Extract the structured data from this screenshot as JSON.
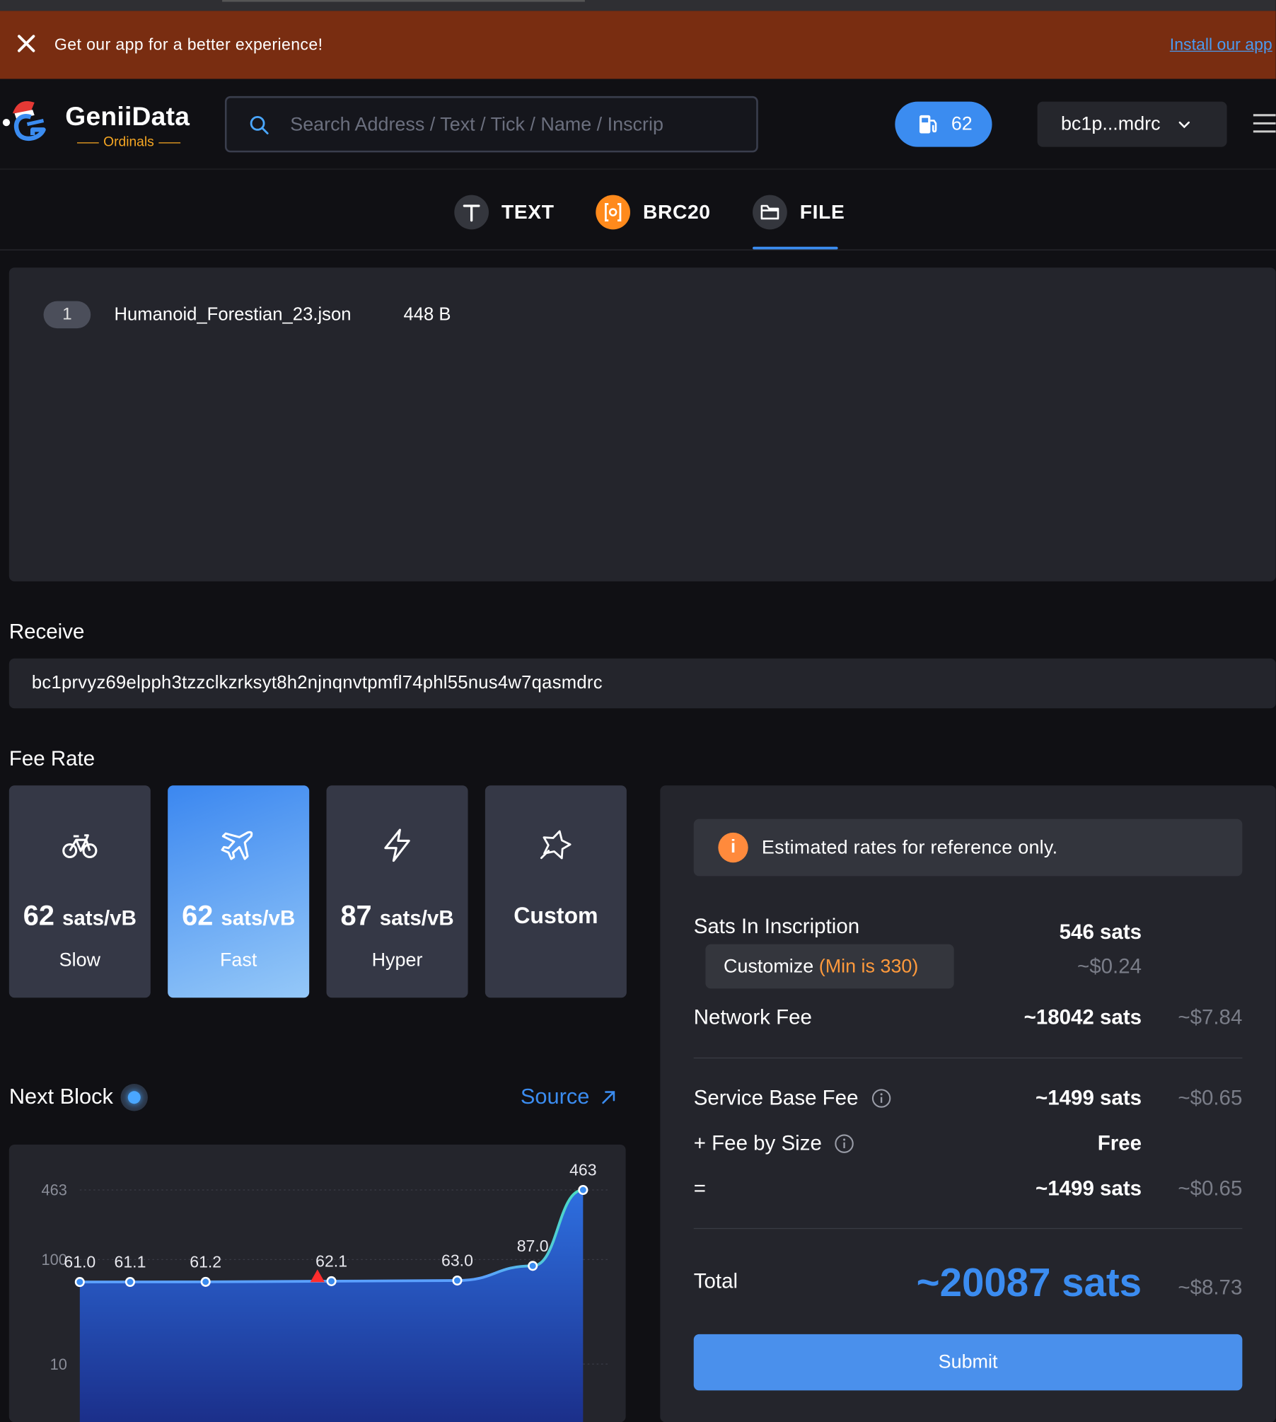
{
  "banner": {
    "message": "Get our app for a better experience!",
    "install_label": "Install our app"
  },
  "header": {
    "logo_name": "GeniiData",
    "logo_sub": "Ordinals",
    "search_placeholder": "Search Address / Text / Tick / Name / Inscrip",
    "gas_value": "62",
    "wallet": "bc1p...mdrc"
  },
  "tabs": [
    {
      "label": "TEXT"
    },
    {
      "label": "BRC20"
    },
    {
      "label": "FILE"
    }
  ],
  "file": {
    "index": "1",
    "name": "Humanoid_Forestian_23.json",
    "size": "448 B"
  },
  "receive": {
    "label": "Receive",
    "address": "bc1prvyz69elpph3tzzclkzrksyt8h2njnqnvtpmfl74phl55nus4w7qasmdrc"
  },
  "fee_rate": {
    "label": "Fee Rate",
    "options": [
      {
        "rate": "62",
        "unit": "sats/vB",
        "speed": "Slow",
        "icon": "bicycle-icon"
      },
      {
        "rate": "62",
        "unit": "sats/vB",
        "speed": "Fast",
        "icon": "airplane-icon"
      },
      {
        "rate": "87",
        "unit": "sats/vB",
        "speed": "Hyper",
        "icon": "lightning-icon"
      },
      {
        "label": "Custom",
        "icon": "custom-star-icon"
      }
    ],
    "selected_index": 1
  },
  "next_block": {
    "label": "Next Block",
    "source_label": "Source"
  },
  "chart_data": {
    "type": "area",
    "x": [
      1,
      2,
      3,
      4,
      5,
      6,
      7
    ],
    "values": [
      61.0,
      61.1,
      61.2,
      62.1,
      63.0,
      87.0,
      463
    ],
    "labels": [
      "61.0",
      "61.1",
      "61.2",
      "62.1",
      "63.0",
      "87.0",
      "463"
    ],
    "y_tick_labels": [
      "463",
      "100",
      "10"
    ],
    "y_ticks": [
      463,
      100,
      10
    ],
    "yscale": "log",
    "marker_value": 62
  },
  "summary": {
    "notice": "Estimated rates for reference only.",
    "sats_in_inscription_label": "Sats In Inscription",
    "sats_in_inscription": "546 sats",
    "sats_in_inscription_usd": "~$0.24",
    "customize_label": "Customize",
    "customize_min": "(Min is 330)",
    "network_fee_label": "Network Fee",
    "network_fee": "~18042 sats",
    "network_fee_usd": "~$7.84",
    "service_base_fee_label": "Service Base Fee",
    "service_base_fee": "~1499 sats",
    "service_base_fee_usd": "~$0.65",
    "fee_by_size_label": "+ Fee by Size",
    "fee_by_size": "Free",
    "equals_label": "=",
    "equals_value": "~1499 sats",
    "equals_usd": "~$0.65",
    "total_label": "Total",
    "total": "~20087 sats",
    "total_usd": "~$8.73",
    "submit_label": "Submit"
  },
  "colors": {
    "accent": "#3b8cf0",
    "banner": "#792d11",
    "brc20": "#ff8a1c",
    "card": "#353846",
    "panel": "#24252c"
  }
}
